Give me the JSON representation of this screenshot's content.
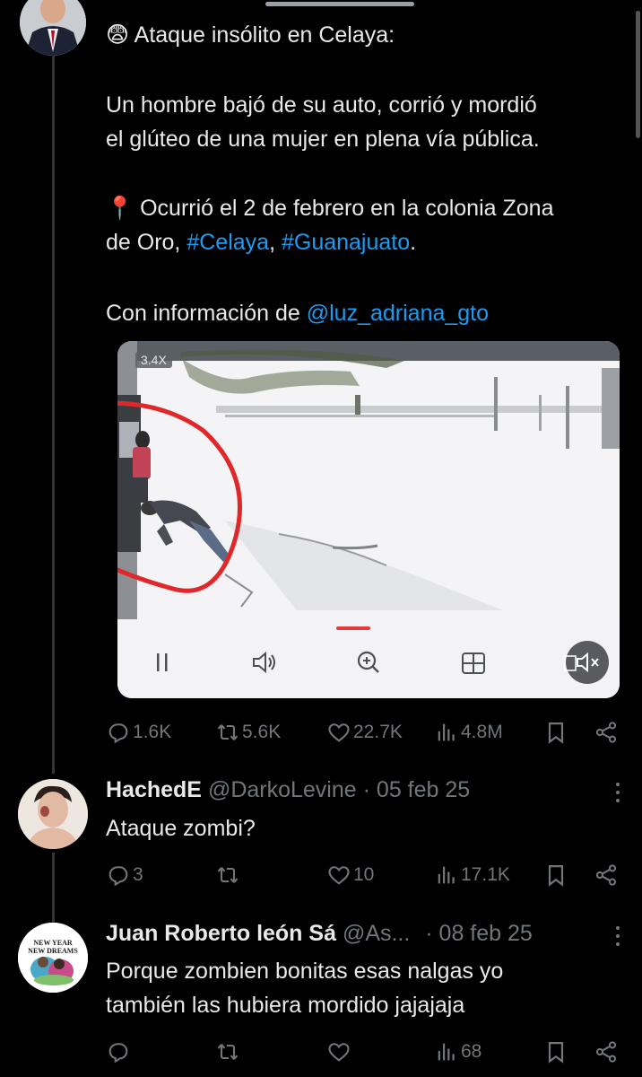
{
  "main_tweet": {
    "emoji": "😨",
    "title_text": "Ataque insólito en Celaya:",
    "para1": "Un hombre bajó de su auto, corrió y mordió\nel glúteo de una mujer en plena vía pública.",
    "pin_emoji": "📍",
    "para2_line1": "Ocurrió el 2 de febrero en la colonia Zona",
    "para2_prefix": "de Oro, ",
    "hashtag1": "#Celaya",
    "sep": ", ",
    "hashtag2": "#Guanajuato",
    "para2_suffix": ".",
    "credit_prefix": "Con información de ",
    "credit_handle": "@luz_adriana_gto",
    "video": {
      "zoom_badge": "3.4X",
      "progress": 0.14
    },
    "stats": {
      "replies": "1.6K",
      "reposts": "5.6K",
      "likes": "22.7K",
      "views": "4.8M"
    }
  },
  "replies": [
    {
      "name": "HachedE",
      "handle": "@DarkoLevine",
      "date": "· 05 feb 25",
      "text": "Ataque zombi?",
      "stats": {
        "replies": "3",
        "reposts": "",
        "likes": "10",
        "views": "17.1K"
      }
    },
    {
      "name": "Juan Roberto león Sá",
      "handle": "@As...",
      "date": "· 08 feb 25",
      "avatar_text": "NEW YEAR NEW DREAMS",
      "text": "Porque zombien bonitas esas nalgas yo\ntambién las hubiera mordido jajajaja",
      "stats": {
        "replies": "",
        "reposts": "",
        "likes": "",
        "views": "68"
      }
    }
  ],
  "colors": {
    "background": "#000000",
    "text": "#e7e9ea",
    "muted": "#71767b",
    "link": "#1d9bf0",
    "annotation_circle": "#e0282a"
  }
}
